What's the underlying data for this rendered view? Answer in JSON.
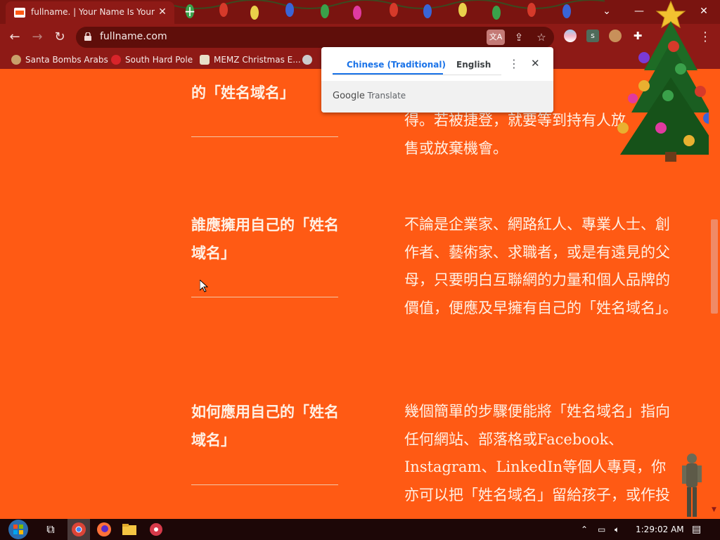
{
  "browser": {
    "tab_title": "fullname. | Your Name Is Your Br",
    "tab_close": "✕",
    "new_tab": "+",
    "url": "fullname.com",
    "window_min": "—",
    "window_max": "☐",
    "window_close": "✕",
    "tab_search": "⌄"
  },
  "bookmarks": [
    {
      "label": "Santa Bombs Arabs"
    },
    {
      "label": "South Hard Pole"
    },
    {
      "label": "MEMZ Christmas E..."
    }
  ],
  "translate_popup": {
    "source_lang": "Chinese (Traditional)",
    "target_lang": "English",
    "brand": "Google",
    "brand_suffix": "Translate"
  },
  "content": {
    "faq": [
      {
        "question": "的「姓名域名」",
        "answer": "得。若被捷登，就要等到持有人放售或放棄機會。"
      },
      {
        "question": "誰應擁用自己的「姓名域名」",
        "answer": "不論是企業家、網路紅人、專業人士、創作者、藝術家、求職者，或是有遠見的父母，只要明白互聯網的力量和個人品牌的價值，便應及早擁有自己的「姓名域名」。"
      },
      {
        "question": "如何應用自己的「姓名域名」",
        "answer": "幾個簡單的步驟便能將「姓名域名」指向任何網站、部落格或Facebook、Instagram、LinkedIn等個人專頁，你亦可以把「姓名域名」留給孩子，或作投"
      }
    ]
  },
  "taskbar": {
    "time": "1:29:02 AM"
  },
  "colors": {
    "page_bg": "#ff5a14",
    "chrome_frame": "#8e1a16",
    "accent_blue": "#1a73e8"
  }
}
